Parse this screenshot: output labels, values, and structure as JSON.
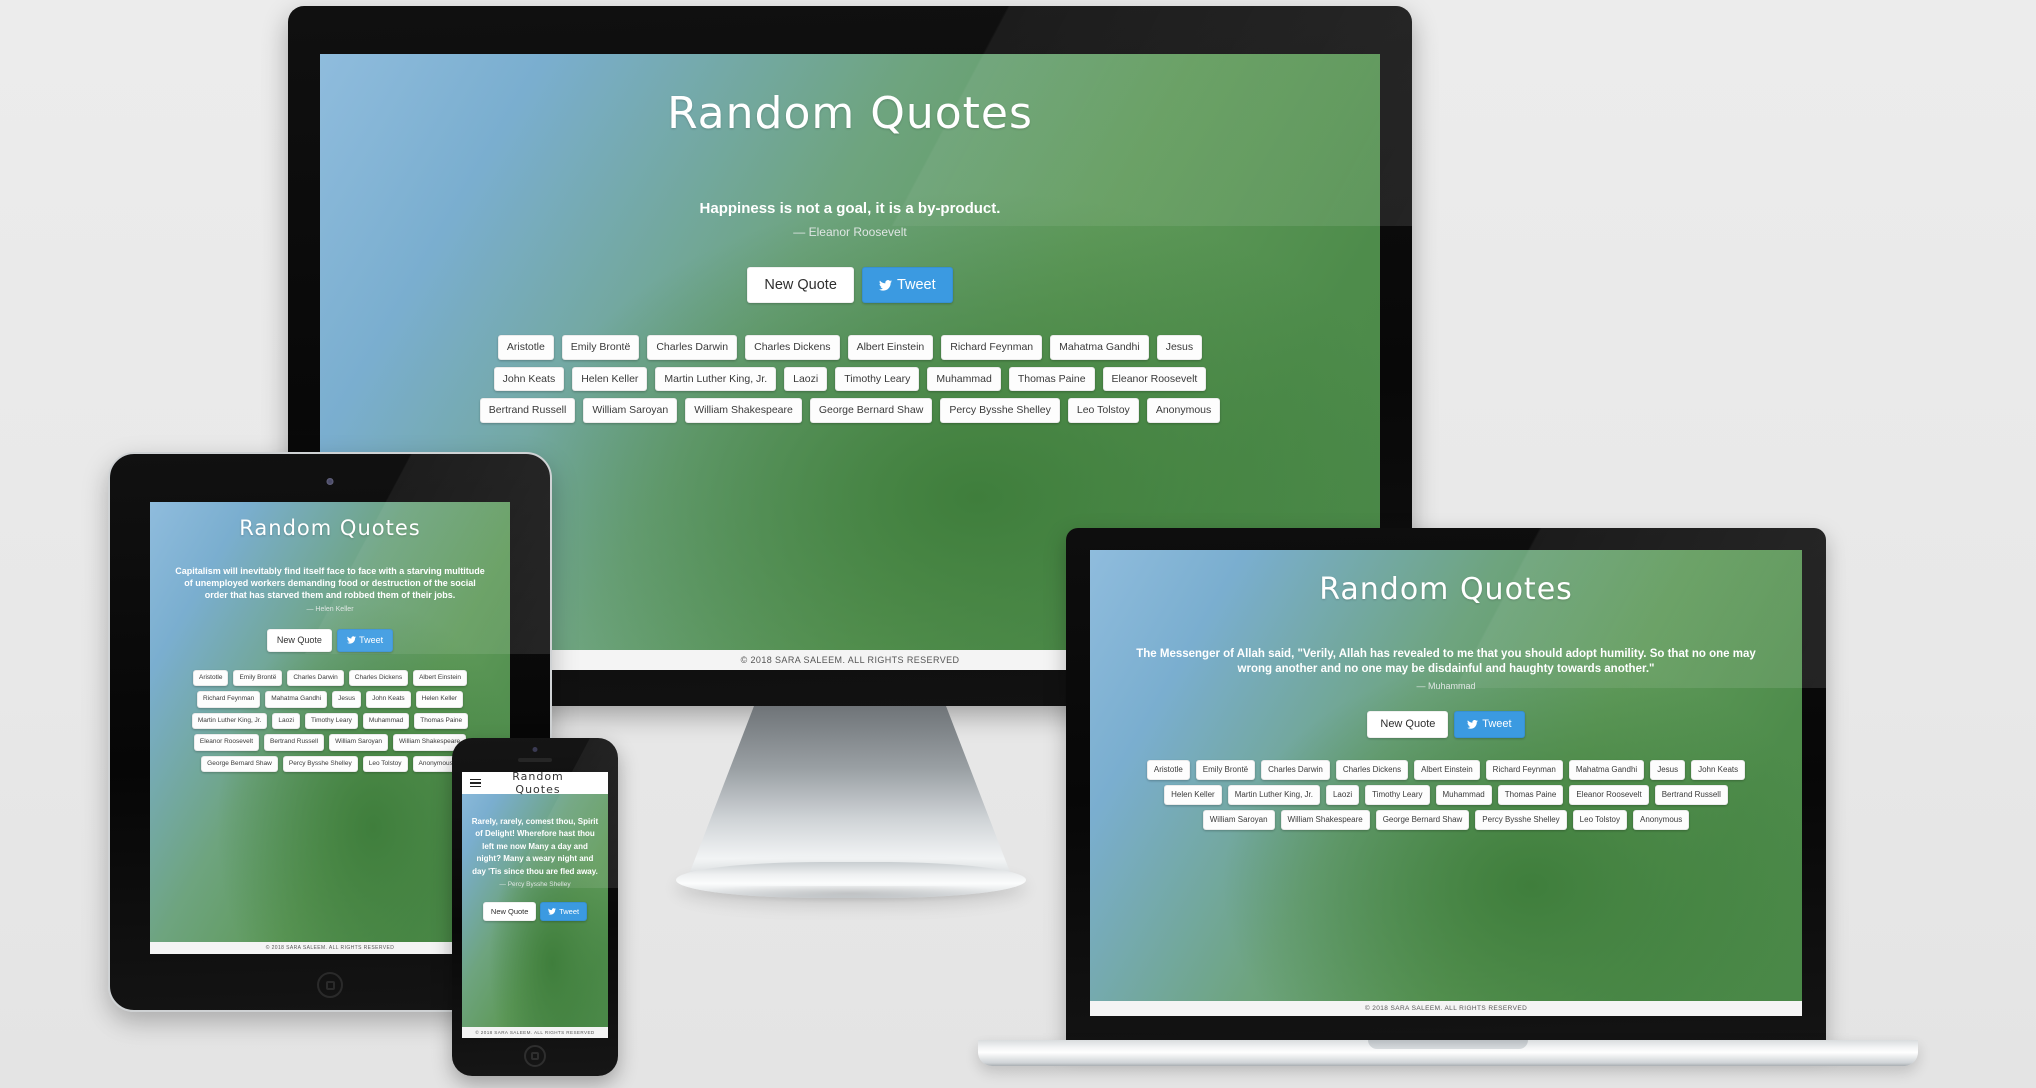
{
  "site": {
    "title": "Random Quotes",
    "footer": "© 2018 SARA SALEEM. ALL RIGHTS RESERVED",
    "new_quote_label": "New Quote",
    "tweet_label": "Tweet",
    "twitter_icon": "twitter-bird-icon",
    "accent_tweet_color": "#3b9ae1",
    "button_bg_color": "#ffffff",
    "page_bg_colors": [
      "#8fbcdd",
      "#6ea47f",
      "#3f7e3c"
    ]
  },
  "authors": [
    "Aristotle",
    "Emily Brontë",
    "Charles Darwin",
    "Charles Dickens",
    "Albert Einstein",
    "Richard Feynman",
    "Mahatma Gandhi",
    "Jesus",
    "John Keats",
    "Helen Keller",
    "Martin Luther King, Jr.",
    "Laozi",
    "Timothy Leary",
    "Muhammad",
    "Thomas Paine",
    "Eleanor Roosevelt",
    "Bertrand Russell",
    "William Saroyan",
    "William Shakespeare",
    "George Bernard Shaw",
    "Percy Bysshe Shelley",
    "Leo Tolstoy",
    "Anonymous"
  ],
  "devices": {
    "desktop": {
      "name": "desktop-monitor",
      "quote": "Happiness is not a goal, it is a by-product.",
      "author": "— Eleanor Roosevelt"
    },
    "laptop": {
      "name": "laptop",
      "quote": "The Messenger of Allah said, \"Verily, Allah has revealed to me that you should adopt humility. So that no one may wrong another and no one may be disdainful and haughty towards another.\"",
      "author": "— Muhammad"
    },
    "tablet": {
      "name": "tablet",
      "quote": "Capitalism will inevitably find itself face to face with a starving multitude of unemployed workers demanding food or destruction of the social order that has starved them and robbed them of their jobs.",
      "author": "— Helen Keller"
    },
    "phone": {
      "name": "phone",
      "quote": "Rarely, rarely, comest thou, Spirit of Delight! Wherefore hast thou left me now Many a day and night? Many a weary night and day 'Tis since thou are fled away.",
      "author": "— Percy Bysshe Shelley",
      "menu_icon": "hamburger-menu-icon"
    }
  }
}
